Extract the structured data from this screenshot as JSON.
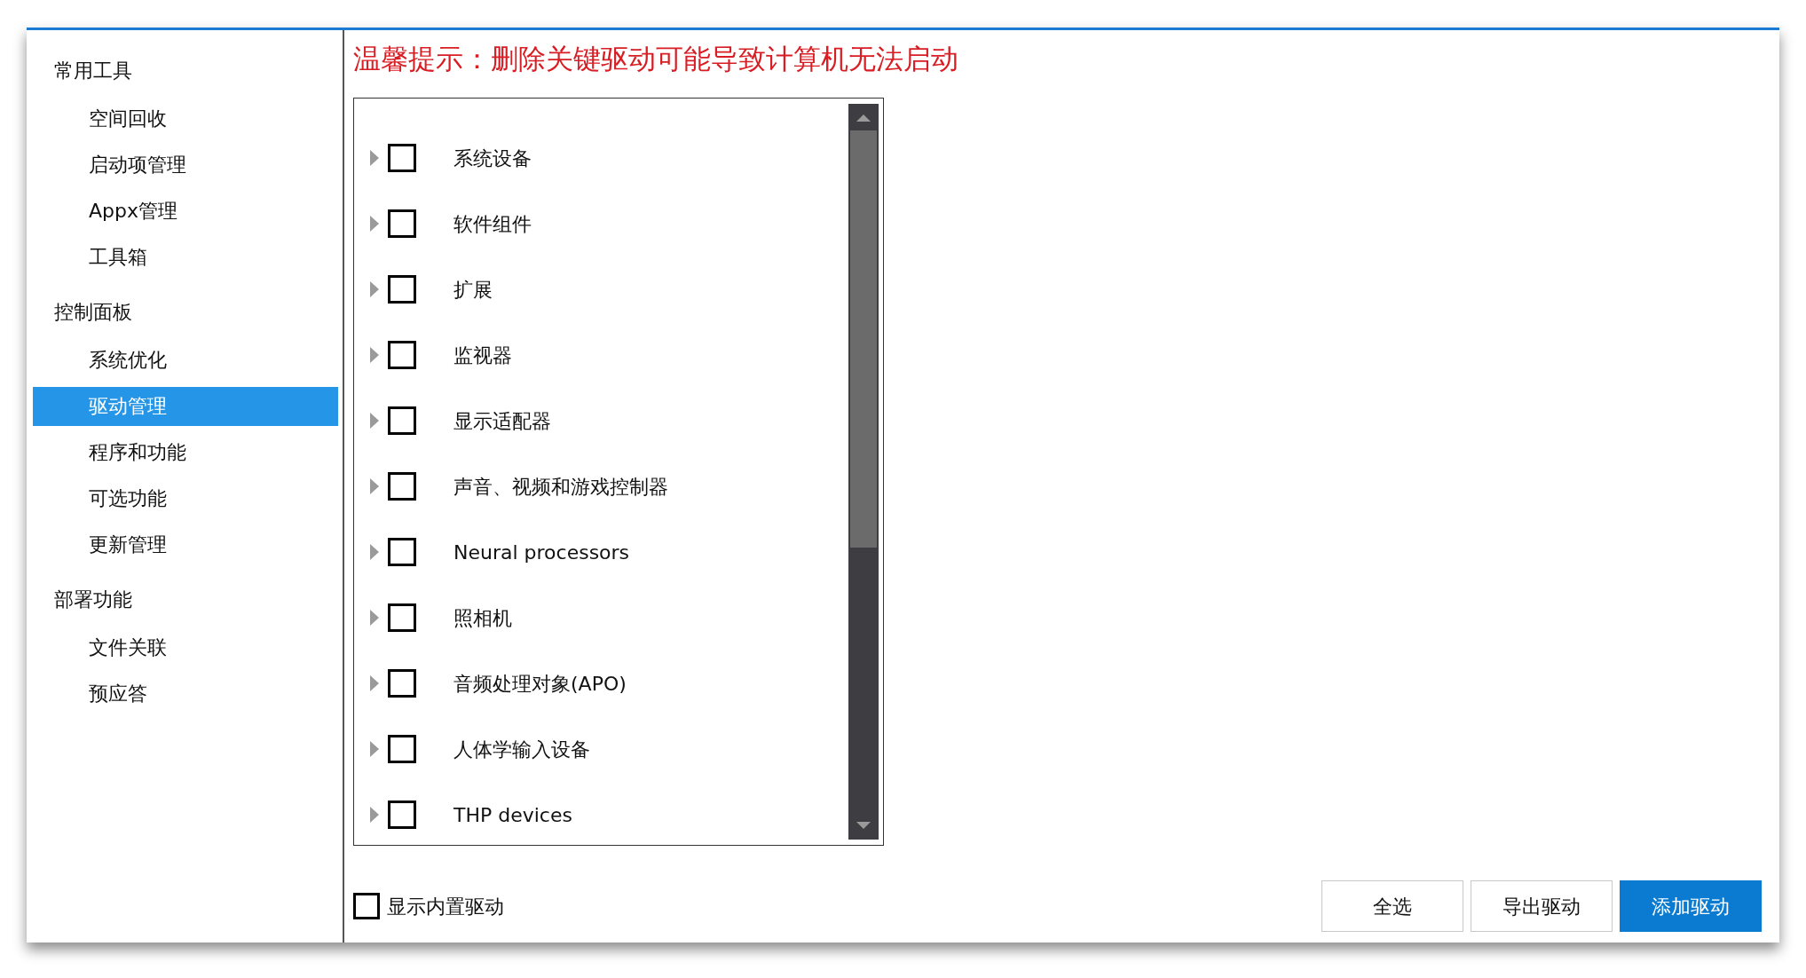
{
  "sidebar": {
    "groups": [
      {
        "title": "常用工具",
        "items": [
          {
            "label": "空间回收",
            "selected": false
          },
          {
            "label": "启动项管理",
            "selected": false
          },
          {
            "label": "Appx管理",
            "selected": false
          },
          {
            "label": "工具箱",
            "selected": false
          }
        ]
      },
      {
        "title": "控制面板",
        "items": [
          {
            "label": "系统优化",
            "selected": false
          },
          {
            "label": "驱动管理",
            "selected": true
          },
          {
            "label": "程序和功能",
            "selected": false
          },
          {
            "label": "可选功能",
            "selected": false
          },
          {
            "label": "更新管理",
            "selected": false
          }
        ]
      },
      {
        "title": "部署功能",
        "items": [
          {
            "label": "文件关联",
            "selected": false
          },
          {
            "label": "预应答",
            "selected": false
          }
        ]
      }
    ]
  },
  "warning": "温馨提示：删除关键驱动可能导致计算机无法启动",
  "driver_tree": [
    {
      "label": "系统设备",
      "expanded": false,
      "checked": false
    },
    {
      "label": "软件组件",
      "expanded": false,
      "checked": false
    },
    {
      "label": "扩展",
      "expanded": false,
      "checked": false
    },
    {
      "label": "监视器",
      "expanded": false,
      "checked": false
    },
    {
      "label": "显示适配器",
      "expanded": false,
      "checked": false
    },
    {
      "label": "声音、视频和游戏控制器",
      "expanded": false,
      "checked": false
    },
    {
      "label": "Neural processors",
      "expanded": false,
      "checked": false
    },
    {
      "label": "照相机",
      "expanded": false,
      "checked": false
    },
    {
      "label": "音频处理对象(APO)",
      "expanded": false,
      "checked": false
    },
    {
      "label": "人体学输入设备",
      "expanded": false,
      "checked": false
    },
    {
      "label": "THP devices",
      "expanded": false,
      "checked": false
    }
  ],
  "show_builtin": {
    "label": "显示内置驱动",
    "checked": false
  },
  "buttons": [
    {
      "label": "全选",
      "kind": "default"
    },
    {
      "label": "导出驱动",
      "kind": "default"
    },
    {
      "label": "添加驱动",
      "kind": "primary"
    }
  ]
}
